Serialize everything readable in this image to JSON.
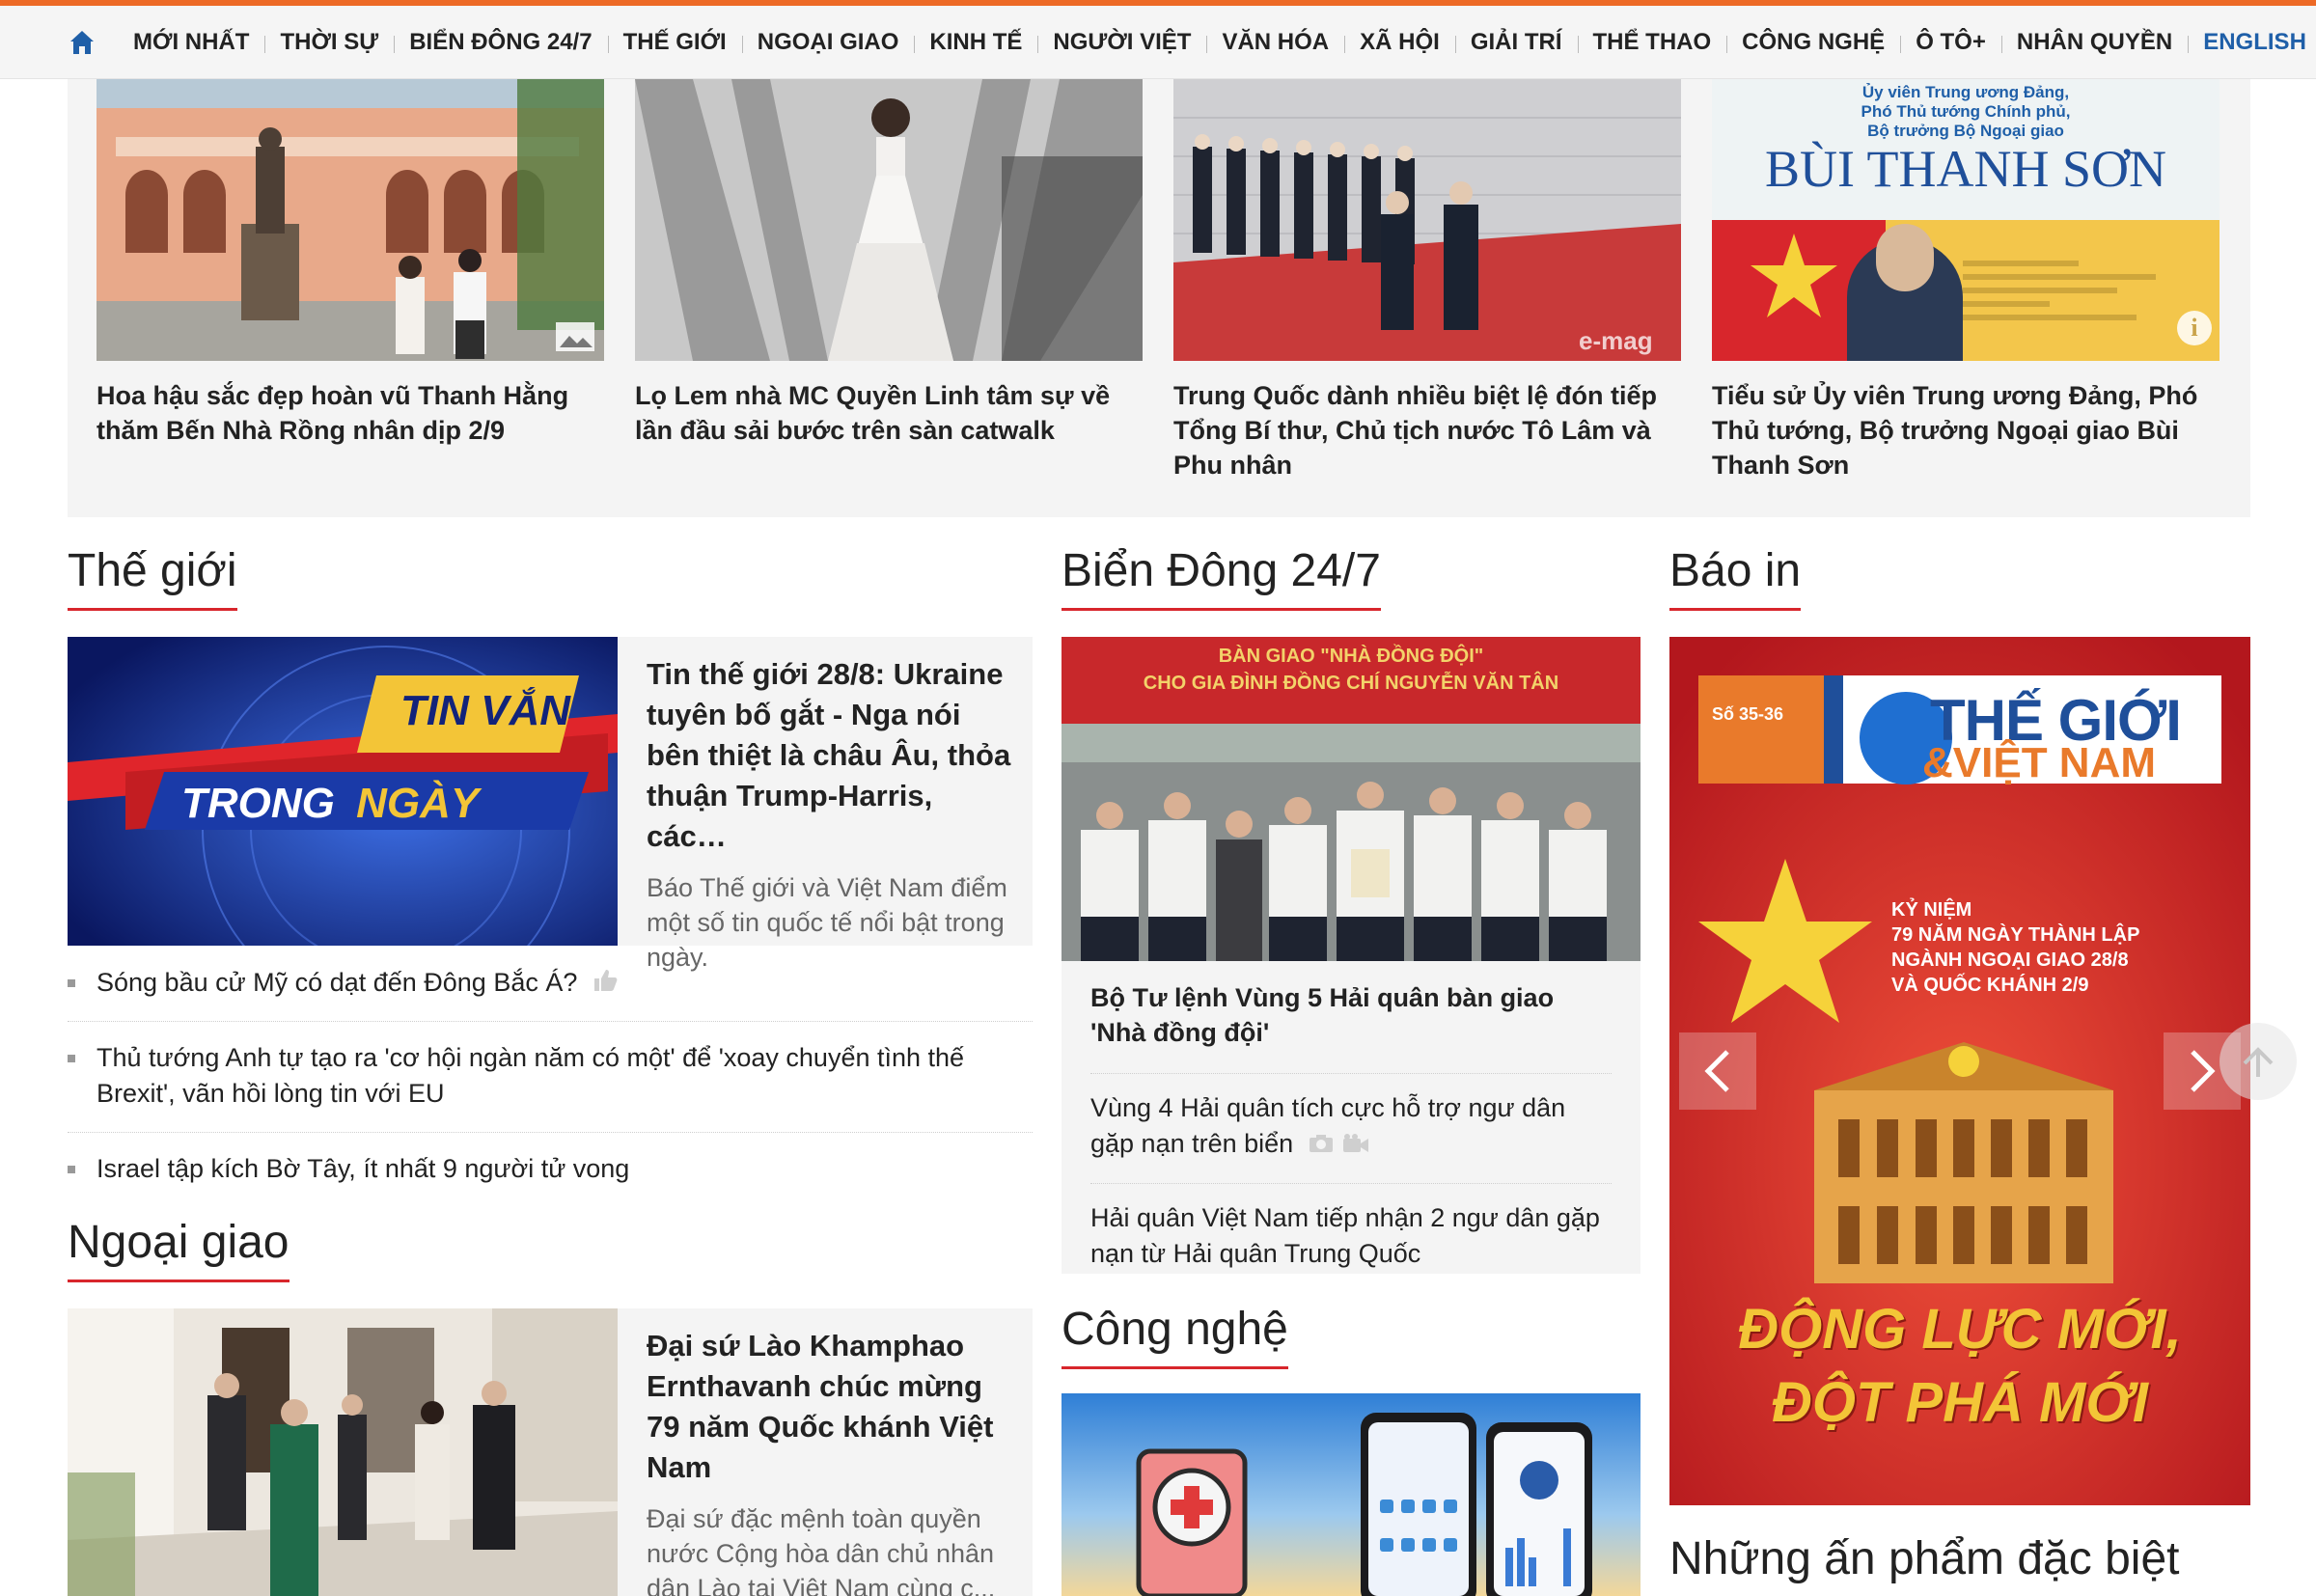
{
  "nav": {
    "items": [
      "MỚI NHẤT",
      "THỜI SỰ",
      "BIỂN ĐÔNG 24/7",
      "THẾ GIỚI",
      "NGOẠI GIAO",
      "KINH TẾ",
      "NGƯỜI VIỆT",
      "VĂN HÓA",
      "XÃ HỘI",
      "GIẢI TRÍ",
      "THỂ THAO",
      "CÔNG NGHỆ",
      "Ô TÔ+",
      "NHÂN QUYỀN"
    ],
    "english": "ENGLISH"
  },
  "featured": [
    {
      "title": "Hoa hậu sắc đẹp hoàn vũ Thanh Hằng thăm Bến Nhà Rồng nhân dịp 2/9"
    },
    {
      "title": "Lọ Lem nhà MC Quyền Linh tâm sự về lần đầu sải bước trên sàn catwalk"
    },
    {
      "title": "Trung Quốc dành nhiều biệt lệ đón tiếp Tổng Bí thư, Chủ tịch nước Tô Lâm và Phu nhân",
      "badge": "e-mag"
    },
    {
      "title": "Tiểu sử Ủy viên Trung ương Đảng, Phó Thủ tướng, Bộ trưởng Ngoại giao Bùi Thanh Sơn",
      "poster": {
        "line1": "Ủy viên Trung ương Đảng,",
        "line2": "Phó Thủ tướng Chính phủ,",
        "line3": "Bộ trưởng Bộ Ngoại giao",
        "name": "BÙI THANH SƠN"
      }
    }
  ],
  "the_gioi": {
    "heading": "Thế giới",
    "lead": {
      "banner_line1": "TIN VẮN",
      "banner_line2a": "TRONG",
      "banner_line2b": "NGÀY",
      "title": "Tin thế giới 28/8: Ukraine tuyên bố gắt - Nga nói bên thiệt là châu Âu, thỏa thuận Trump-Harris, các…",
      "summary": "Báo Thế giới và Việt Nam điểm một số tin quốc tế nổi bật trong ngày."
    },
    "items": [
      "Sóng bầu cử Mỹ có dạt đến Đông Bắc Á?",
      "Thủ tướng Anh tự tạo ra 'cơ hội ngàn năm có một' để 'xoay chuyển tình thế Brexit', vãn hồi lòng tin với EU",
      "Israel tập kích Bờ Tây, ít nhất 9 người tử vong"
    ]
  },
  "ngoai_giao": {
    "heading": "Ngoại giao",
    "lead": {
      "title": "Đại sứ Lào Khamphao Ernthavanh chúc mừng 79 năm Quốc khánh Việt Nam",
      "summary": "Đại sứ đặc mệnh toàn quyền nước Cộng hòa dân chủ nhân dân Lào tại Việt Nam cùng c..."
    }
  },
  "bien_dong": {
    "heading": "Biển Đông 24/7",
    "lead": {
      "banner_line1": "BÀN GIAO \"NHÀ ĐỒNG ĐỘI\"",
      "banner_line2": "CHO GIA ĐÌNH ĐỒNG CHÍ NGUYỄN VĂN TÂN",
      "title": "Bộ Tư lệnh Vùng 5 Hải quân bàn giao 'Nhà đồng đội'"
    },
    "items": [
      "Vùng 4 Hải quân tích cực hỗ trợ ngư dân gặp nạn trên biển",
      "Hải quân Việt Nam tiếp nhận 2 ngư dân gặp nạn từ Hải quân Trung Quốc"
    ]
  },
  "cong_nghe": {
    "heading": "Công nghệ"
  },
  "bao_in": {
    "heading": "Báo in",
    "cover": {
      "masthead1": "THẾ GIỚI",
      "masthead2": "&VIỆT NAM",
      "issue": "Số 35-36",
      "headline1": "KỶ NIỆM",
      "headline2": "79 NĂM NGÀY THÀNH LẬP",
      "headline3": "NGÀNH NGOẠI GIAO 28/8",
      "headline4": "VÀ QUỐC KHÁNH 2/9",
      "slogan1": "ĐỘNG LỰC MỚI,",
      "slogan2": "ĐỘT PHÁ MỚI"
    }
  },
  "special": {
    "heading": "Những ấn phẩm đặc biệt"
  },
  "colors": {
    "accent": "#ed6a26",
    "underline": "#d8262c",
    "english_link": "#1f5fa8"
  }
}
